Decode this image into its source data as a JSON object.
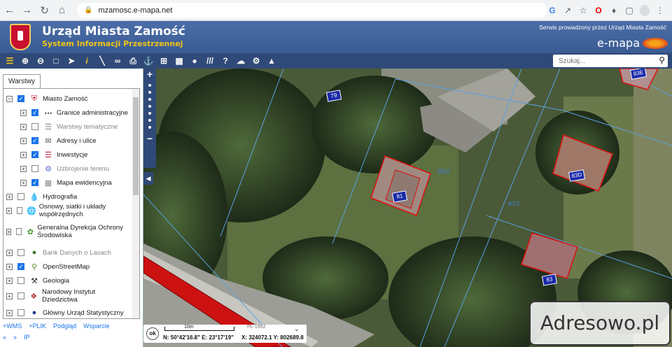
{
  "browser": {
    "url": "mzamosc.e-mapa.net",
    "back_icon": "arrow-left-icon",
    "forward_icon": "arrow-right-icon",
    "reload_icon": "reload-icon",
    "home_icon": "home-icon"
  },
  "header": {
    "title": "Urząd Miasta Zamość",
    "subtitle": "System Informacji Przestrzennej",
    "service_note": "Serwis prowadzony przez Urząd Miasta Zamość",
    "brand": "e-mapa",
    "colors": {
      "bar": "#3f5f96",
      "subtitle": "#f0c419",
      "toolbar": "#2f4a78"
    }
  },
  "toolbar": {
    "icons": [
      "layers-icon",
      "zoom-in-icon",
      "zoom-out-icon",
      "zoom-extent-icon",
      "select-arrow-icon",
      "info-icon",
      "measure-icon",
      "link-icon",
      "print-icon",
      "anchor-icon",
      "export-icon",
      "table-icon",
      "comment-icon",
      "hatch-icon",
      "help-icon",
      "cloud-icon",
      "settings-icon",
      "compass-icon"
    ],
    "search_placeholder": "Szukaj..."
  },
  "panel": {
    "tab_label": "Warstwy",
    "layers": [
      {
        "label": "Miasto Zamość",
        "checked": true,
        "icon": "shield-icon",
        "expand": "−",
        "muted": false
      },
      {
        "label": "Granice administracyjne",
        "checked": true,
        "icon": "border-line-icon",
        "expand": "+",
        "muted": false
      },
      {
        "label": "Warstwy tematyczne",
        "checked": false,
        "icon": "layers-stack-icon",
        "expand": "+",
        "muted": true
      },
      {
        "label": "Adresy i ulice",
        "checked": true,
        "icon": "envelope-icon",
        "expand": "+",
        "muted": false
      },
      {
        "label": "Inwestycje",
        "checked": true,
        "icon": "construction-icon",
        "expand": "+",
        "muted": false
      },
      {
        "label": "Uzbrojenie terenu",
        "checked": false,
        "icon": "utilities-icon",
        "expand": "+",
        "muted": true
      },
      {
        "label": "Mapa ewidencyjna",
        "checked": true,
        "icon": "parcel-map-icon",
        "expand": "+",
        "muted": false
      },
      {
        "label": "Hydrografia",
        "checked": false,
        "icon": "water-drop-icon",
        "expand": "+",
        "muted": false
      },
      {
        "label": "Osnowy, siatki i układy współrzędnych",
        "checked": false,
        "icon": "globe-grid-icon",
        "expand": "+",
        "muted": false
      },
      {
        "label": "Generalna Dyrekcja Ochrony Środowiska",
        "checked": false,
        "icon": "leaf-icon",
        "expand": "+",
        "muted": false
      },
      {
        "label": "Bank Danych o Lasach",
        "checked": false,
        "icon": "tree-icon",
        "expand": "+",
        "muted": true
      },
      {
        "label": "OpenStreetMap",
        "checked": true,
        "icon": "magnifier-map-icon",
        "expand": "+",
        "muted": false
      },
      {
        "label": "Geologia",
        "checked": false,
        "icon": "hammers-icon",
        "expand": "+",
        "muted": false
      },
      {
        "label": "Narodowy Instytut Dziedzictwa",
        "checked": false,
        "icon": "heritage-icon",
        "expand": "+",
        "muted": false
      },
      {
        "label": "Główny Urząd Statystyczny",
        "checked": false,
        "icon": "statistics-icon",
        "expand": "+",
        "muted": false
      }
    ],
    "links": [
      "+WMS",
      "+PLIK",
      "Podgląd",
      "Wsparcie"
    ],
    "links2": [
      "«",
      "»",
      "IP"
    ]
  },
  "map": {
    "parcel_labels": [
      "79",
      "81",
      "83D",
      "83",
      "83E"
    ],
    "boundary_labels": [
      "40/1",
      "35/2"
    ],
    "status": {
      "ok": "ok",
      "scale": "10m",
      "crs": "PL-1992",
      "geo": "N: 50°42'16.8\"  E: 23°17'19\"",
      "xy": "X: 324072.1  Y: 802689.8"
    }
  },
  "watermark": "Adresowo.pl"
}
